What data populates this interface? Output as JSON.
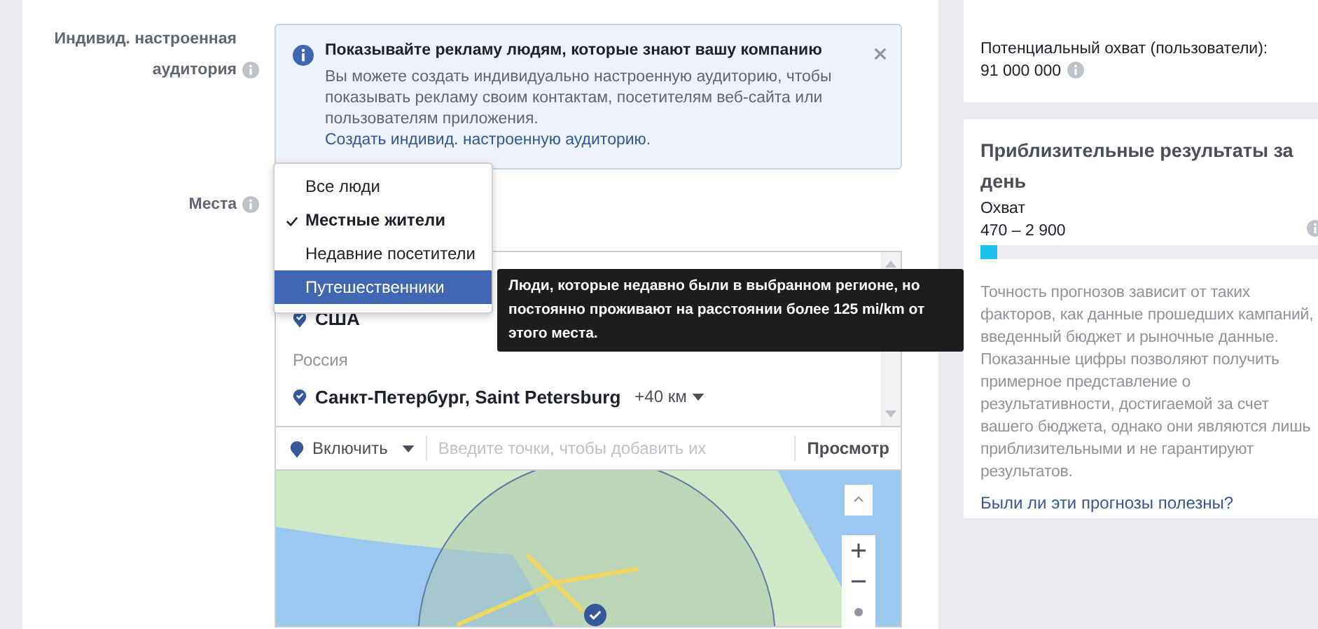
{
  "audience": {
    "label": "Индивид. настроенная аудитория",
    "notice": {
      "title": "Показывайте рекламу людям, которые знают вашу компанию",
      "text": "Вы можете создать индивидуально настроенную аудиторию, чтобы показывать рекламу своим контактам, посетителям веб-сайта или пользователям приложения.",
      "link": "Создать индивид. настроенную аудиторию",
      "text_after": "."
    }
  },
  "places": {
    "label": "Места",
    "options": [
      {
        "label": "Все люди",
        "checked": false,
        "selected": false
      },
      {
        "label": "Местные жители",
        "checked": true,
        "selected": false
      },
      {
        "label": "Недавние посетители",
        "checked": false,
        "selected": false
      },
      {
        "label": "Путешественники",
        "checked": false,
        "selected": true
      }
    ],
    "tooltip": "Люди, которые недавно были в выбранном регионе, но постоянно проживают на расстоянии более 125 mi/km от этого места.",
    "locations": [
      {
        "kind": "place",
        "name": "США"
      },
      {
        "kind": "group",
        "name": "Россия"
      },
      {
        "kind": "place",
        "name": "Санкт-Петербург, Saint Petersburg",
        "radius": "+40 км"
      }
    ],
    "mode": "Включить",
    "placeholder": "Введите точки, чтобы добавить их",
    "view_button": "Просмотр"
  },
  "reach": {
    "label": "Потенциальный охват (пользователи):",
    "value": "91 000 000"
  },
  "estimate": {
    "title": "Приблизительные результаты за день",
    "metric": "Охват",
    "range": "470 – 2 900",
    "level": 0.05,
    "note": "Точность прогнозов зависит от таких факторов, как данные прошедших кампаний, введенный бюджет и рыночные данные. Показанные цифры позволяют получить примерное представление о результативности, достигаемой за счет вашего бюджета, однако они являются лишь приблизительными и не гарантируют результатов.",
    "link": "Были ли эти прогнозы полезны?"
  }
}
